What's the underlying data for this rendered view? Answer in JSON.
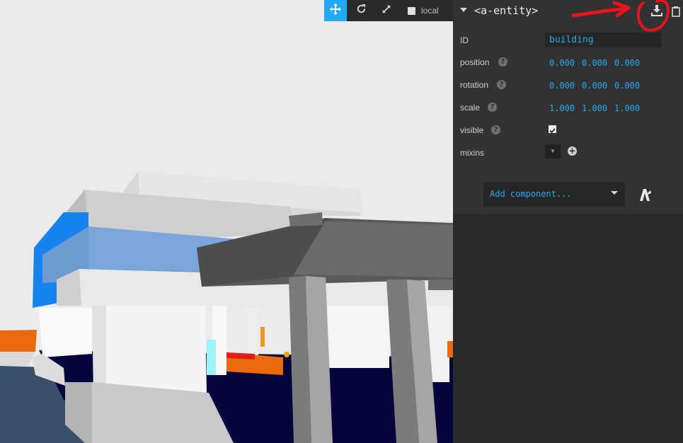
{
  "toolbar": {
    "translate_icon": "move-icon",
    "rotate_icon": "rotate-icon",
    "scale_icon": "expand-icon",
    "local_label": "local"
  },
  "inspector": {
    "entity_title": "<a-entity>",
    "export_icon": "download-icon",
    "copy_icon": "clipboard-icon",
    "id_label": "ID",
    "id_value": "building",
    "position_label": "position",
    "position": [
      "0.000",
      "0.000",
      "0.000"
    ],
    "rotation_label": "rotation",
    "rotation": [
      "0.000",
      "0.000",
      "0.000"
    ],
    "scale_label": "scale",
    "scale": [
      "1.000",
      "1.000",
      "1.000"
    ],
    "visible_label": "visible",
    "visible": true,
    "mixins_label": "mixins",
    "add_component_label": "Add component...",
    "help_glyph": "?"
  },
  "colors": {
    "accent": "#1faaf2",
    "annotation": "#e8141c"
  }
}
